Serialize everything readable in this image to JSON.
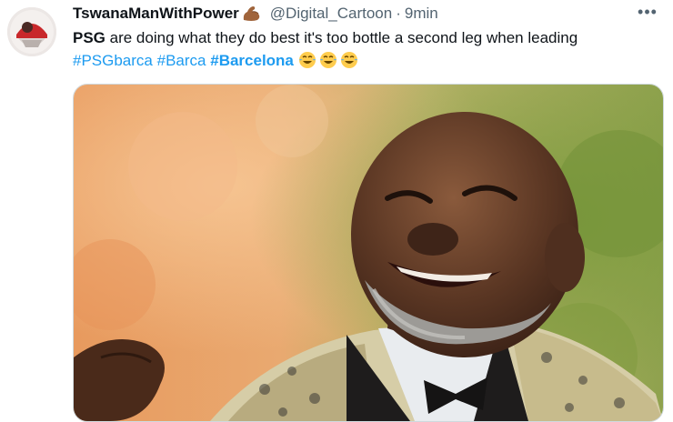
{
  "tweet": {
    "author": {
      "display_name": "TswanaManWithPower",
      "name_emoji": "flexed-biceps-emoji",
      "handle": "@Digital_Cartoon",
      "separator": "·",
      "time": "9min"
    },
    "more_label": "•••",
    "text": {
      "bold_lead": "PSG",
      "body": " are doing what they do best it's too bottle a second leg when leading",
      "hashtags": [
        "#PSGbarca",
        "#Barca",
        "#Barcelona"
      ],
      "trailing_emoji": [
        "face-with-tears-of-joy-emoji",
        "face-with-tears-of-joy-emoji",
        "face-with-tears-of-joy-emoji"
      ]
    },
    "media": {
      "type": "photo",
      "subject": "man-laughing-photo"
    }
  },
  "colors": {
    "link": "#1d9bf0",
    "text": "#0f1419",
    "secondary": "#536471",
    "border": "#cfd9de"
  }
}
